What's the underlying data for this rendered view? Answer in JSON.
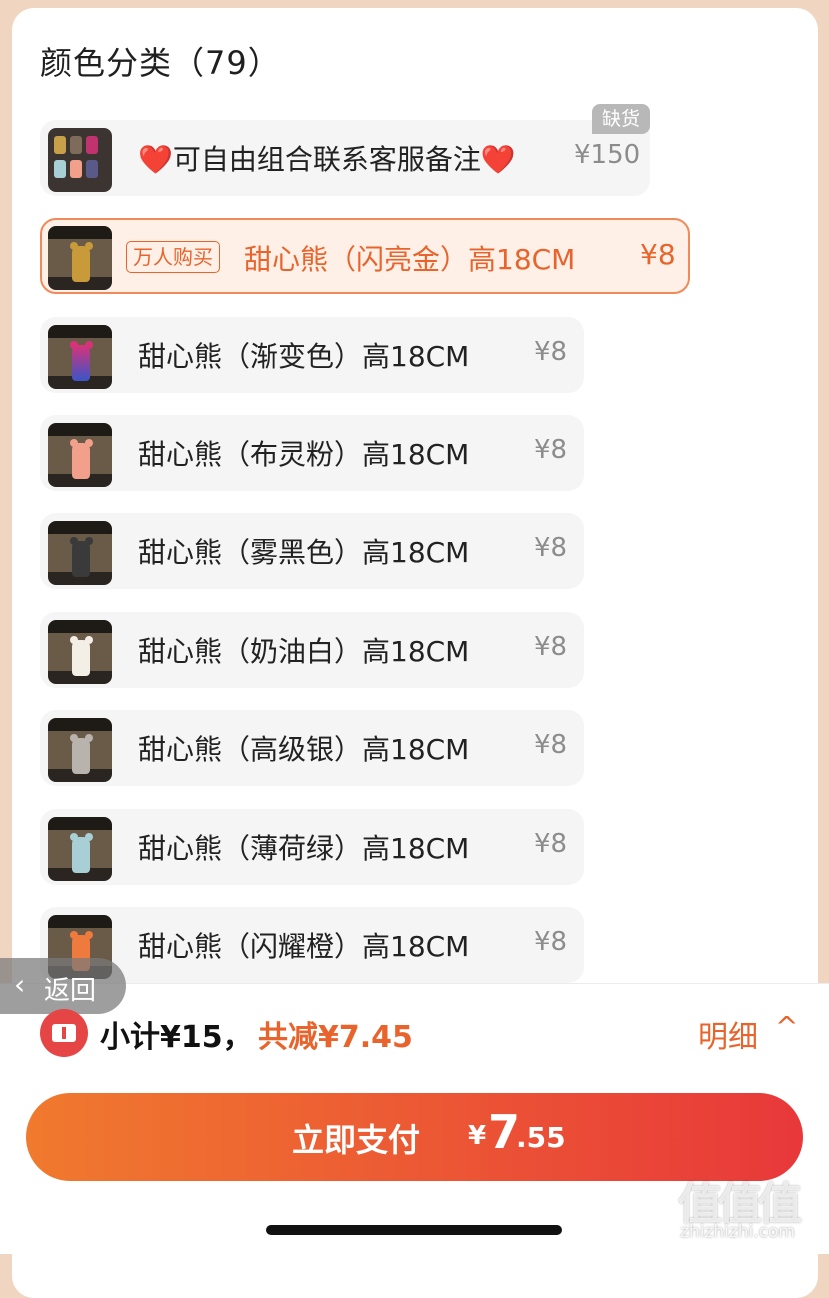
{
  "section_title": "颜色分类（79）",
  "out_of_stock_badge": "缺货",
  "options": [
    {
      "label": "❤️可自由组合联系客服备注❤️",
      "price": "¥150",
      "selected": false,
      "out_of_stock": true
    },
    {
      "label": "甜心熊（闪亮金）高18CM",
      "price": "¥8",
      "selected": true,
      "badge": "万人购买",
      "color": "#c99a3a"
    },
    {
      "label": "甜心熊（渐变色）高18CM",
      "price": "¥8",
      "color": "#c0336e"
    },
    {
      "label": "甜心熊（布灵粉）高18CM",
      "price": "¥8",
      "color": "#f2a08c"
    },
    {
      "label": "甜心熊（雾黑色）高18CM",
      "price": "¥8",
      "color": "#3a3a3a"
    },
    {
      "label": "甜心熊（奶油白）高18CM",
      "price": "¥8",
      "color": "#f4efe6"
    },
    {
      "label": "甜心熊（高级银）高18CM",
      "price": "¥8",
      "color": "#b9b3ae"
    },
    {
      "label": "甜心熊（薄荷绿）高18CM",
      "price": "¥8",
      "color": "#a9cfd6"
    },
    {
      "label": "甜心熊（闪耀橙）高18CM",
      "price": "¥8",
      "color": "#ef7a3e"
    }
  ],
  "back_label": "返回",
  "subtotal_text": "小计¥15，",
  "discount_text": "共减¥7.45",
  "detail_label": "明细",
  "pay": {
    "label": "立即支付",
    "currency": "¥",
    "amount_int": "7",
    "amount_dec": ".55"
  },
  "watermark": {
    "logo": "值值值",
    "url": "zhizhizhi.com"
  },
  "colors": {
    "accent": "#e8642c",
    "button_start": "#f07a2e",
    "button_end": "#e8383a"
  }
}
